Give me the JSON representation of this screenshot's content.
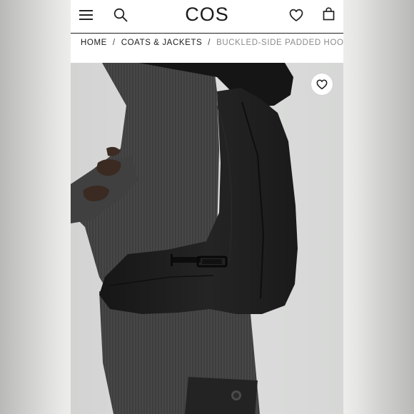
{
  "header": {
    "logo_text": "COS",
    "icons": [
      "menu-icon",
      "search-icon",
      "heart-icon",
      "shopping-bag-icon"
    ]
  },
  "breadcrumb": {
    "items": [
      "HOME",
      "COATS & JACKETS",
      "BUCKLED-SIDE PADDED HOODED GILET"
    ],
    "separator": "/"
  },
  "product_image": {
    "wishlist_icon": "heart-icon"
  },
  "colors": {
    "header_background": "#ffffff",
    "text": "#1b1b1b",
    "breadcrumb_current": "#8b8b8b",
    "image_background": "#d7d8d7"
  }
}
